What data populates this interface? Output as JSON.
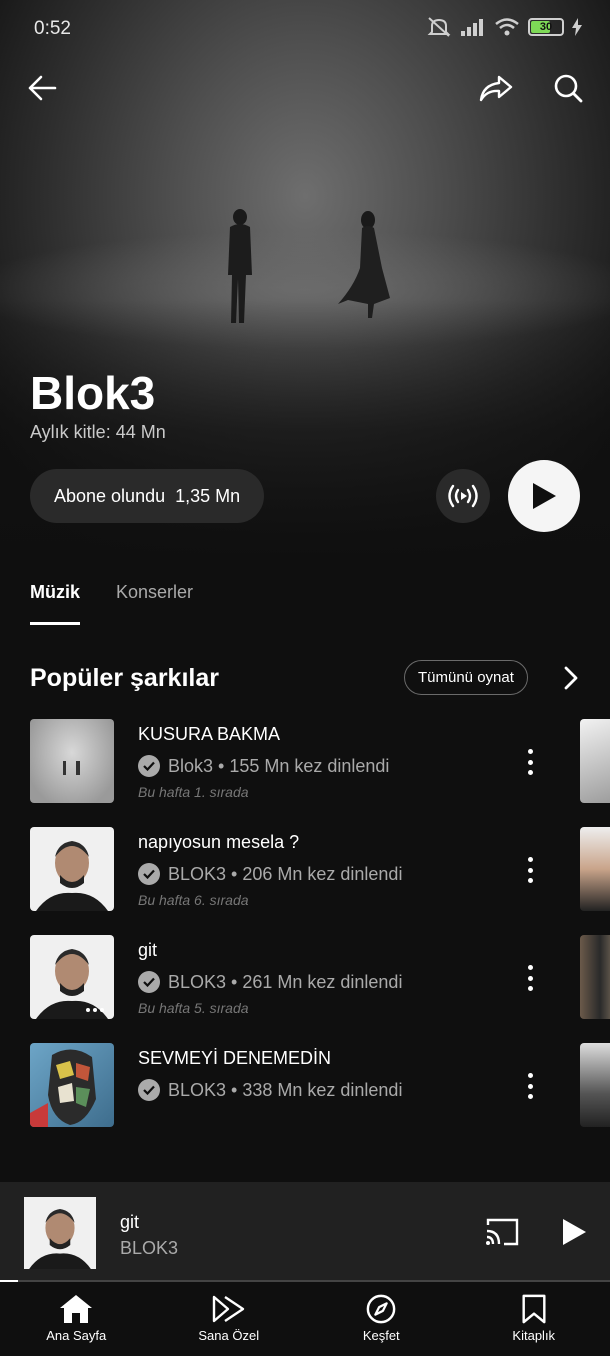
{
  "status": {
    "time": "0:52",
    "battery": "30"
  },
  "artist": {
    "name": "Blok3",
    "listeners": "Aylık kitle: 44 Mn",
    "subscribe_label": "Abone olundu",
    "subscribe_count": "1,35 Mn"
  },
  "tabs": [
    {
      "label": "Müzik",
      "active": true
    },
    {
      "label": "Konserler",
      "active": false
    }
  ],
  "popular": {
    "title": "Popüler şarkılar",
    "play_all": "Tümünü oynat",
    "tracks": [
      {
        "title": "KUSURA BAKMA",
        "meta": "Blok3 • 155 Mn kez dinlendi",
        "rank": "Bu hafta 1. sırada"
      },
      {
        "title": "napıyosun mesela ?",
        "meta": "BLOK3 • 206 Mn kez dinlendi",
        "rank": "Bu hafta 6. sırada"
      },
      {
        "title": "git",
        "meta": "BLOK3 • 261 Mn kez dinlendi",
        "rank": "Bu hafta 5. sırada"
      },
      {
        "title": "SEVMEYİ DENEMEDİN",
        "meta": "BLOK3 • 338 Mn kez dinlendi",
        "rank": ""
      }
    ]
  },
  "now_playing": {
    "title": "git",
    "artist": "BLOK3",
    "progress": 0.03
  },
  "nav": [
    {
      "label": "Ana Sayfa",
      "icon": "home-icon"
    },
    {
      "label": "Sana Özel",
      "icon": "samples-icon"
    },
    {
      "label": "Keşfet",
      "icon": "compass-icon"
    },
    {
      "label": "Kitaplık",
      "icon": "bookmark-icon"
    }
  ],
  "colors": {
    "background": "#0f0f0f",
    "surface": "#212121",
    "accent": "#ffffff",
    "muted": "#aaaaaa"
  }
}
